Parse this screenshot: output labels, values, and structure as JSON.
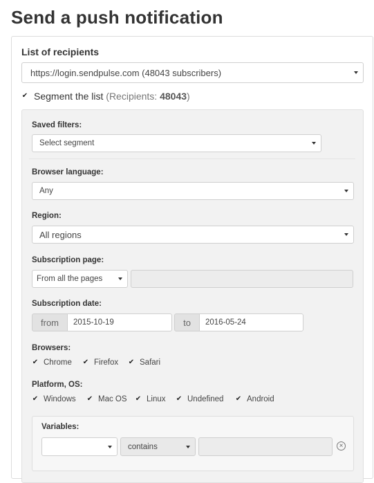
{
  "page": {
    "title": "Send a push notification"
  },
  "recipients": {
    "label": "List of recipients",
    "selected": "https://login.sendpulse.com (48043 subscribers)",
    "segment_label": "Segment the list",
    "recipients_prefix": "(Recipients: ",
    "recipients_count": "48043",
    "recipients_suffix": ")",
    "segment_checked": true
  },
  "filters": {
    "saved_filters": {
      "label": "Saved filters:",
      "value": "Select segment"
    },
    "browser_language": {
      "label": "Browser language:",
      "value": "Any"
    },
    "region": {
      "label": "Region:",
      "value": "All regions"
    },
    "subscription_page": {
      "label": "Subscription page:",
      "value": "From all the pages",
      "url_value": ""
    },
    "subscription_date": {
      "label": "Subscription date:",
      "from_label": "from",
      "from_value": "2015-10-19",
      "to_label": "to",
      "to_value": "2016-05-24"
    },
    "browsers": {
      "label": "Browsers:",
      "items": [
        {
          "label": "Chrome",
          "checked": true
        },
        {
          "label": "Firefox",
          "checked": true
        },
        {
          "label": "Safari",
          "checked": true
        }
      ]
    },
    "platforms": {
      "label": "Platform, OS:",
      "items": [
        {
          "label": "Windows",
          "checked": true
        },
        {
          "label": "Mac OS",
          "checked": true
        },
        {
          "label": "Linux",
          "checked": true
        },
        {
          "label": "Undefined",
          "checked": true
        },
        {
          "label": "Android",
          "checked": true
        }
      ]
    },
    "variables": {
      "label": "Variables:",
      "variable_value": "",
      "operator_value": "contains",
      "value_value": ""
    }
  },
  "icons": {
    "check": "check-mark-icon",
    "caret": "caret-down-icon",
    "remove": "circle-x-icon"
  }
}
